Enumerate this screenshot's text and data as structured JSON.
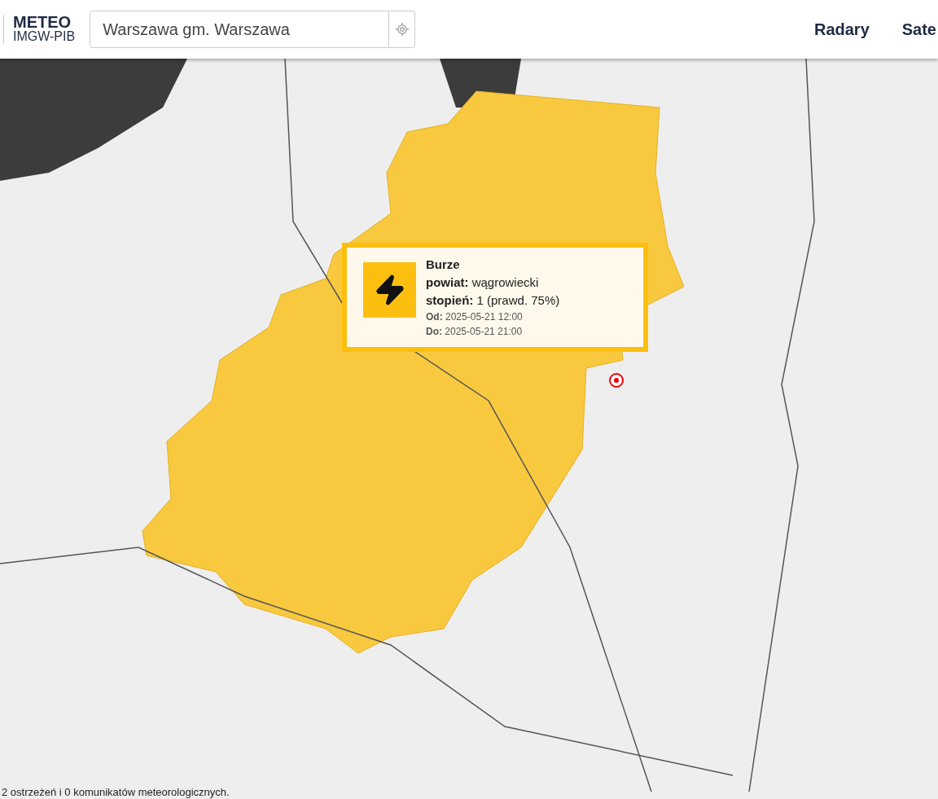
{
  "logo": {
    "line_1": "METEO",
    "line_2": "IMGW-PIB"
  },
  "search": {
    "value": "Warszawa gm. Warszawa"
  },
  "nav": [
    "Radary",
    "Sate"
  ],
  "warning_popup": {
    "title": "Burze",
    "fields": [
      {
        "label": "powiat:",
        "value": "wągrowiecki"
      },
      {
        "label": "stopień:",
        "value": "1 (prawd. 75%)"
      }
    ],
    "period": [
      {
        "label": "Od:",
        "value": "2025-05-21 12:00"
      },
      {
        "label": "Do:",
        "value": "2025-05-21 21:00"
      }
    ]
  },
  "status_text": "2 ostrzeżeń i 0 komunikatów meteorologicznych."
}
